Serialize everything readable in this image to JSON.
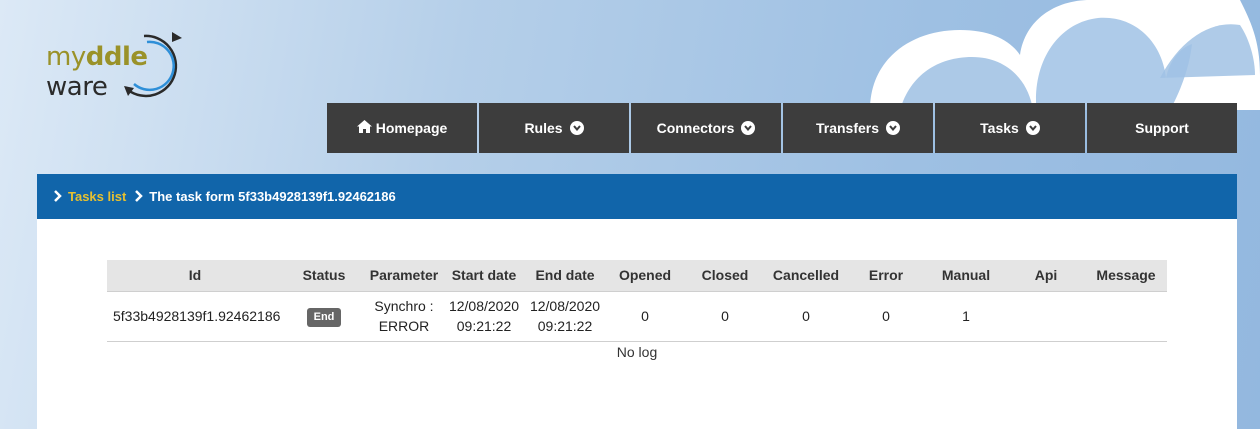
{
  "logo": {
    "line1_my": "my",
    "line1_ddle": "ddle",
    "line2": "ware"
  },
  "nav": {
    "items": [
      {
        "label": "Homepage",
        "icon": "home-icon"
      },
      {
        "label": "Rules",
        "icon": "chevron-down-icon"
      },
      {
        "label": "Connectors",
        "icon": "chevron-down-icon"
      },
      {
        "label": "Transfers",
        "icon": "chevron-down-icon"
      },
      {
        "label": "Tasks",
        "icon": "chevron-down-icon"
      },
      {
        "label": "Support"
      }
    ]
  },
  "breadcrumb": {
    "link": "Tasks list",
    "current": "The task form 5f33b4928139f1.92462186"
  },
  "table": {
    "headers": [
      "Id",
      "Status",
      "Parameter",
      "Start date",
      "End date",
      "Opened",
      "Closed",
      "Cancelled",
      "Error",
      "Manual",
      "Api",
      "Message"
    ],
    "row": {
      "id": "5f33b4928139f1.92462186",
      "status": "End",
      "parameter_line1": "Synchro :",
      "parameter_line2": "ERROR",
      "start_date": "12/08/2020",
      "start_time": "09:21:22",
      "end_date": "12/08/2020",
      "end_time": "09:21:22",
      "opened": "0",
      "closed": "0",
      "cancelled": "0",
      "error": "0",
      "manual": "1",
      "api": "",
      "message": ""
    }
  },
  "no_log": "No log",
  "colors": {
    "nav_bg": "#3d3d3d",
    "crumb_bg": "#1165aa",
    "crumb_link": "#e6c030",
    "logo_olive": "#9a9229"
  }
}
